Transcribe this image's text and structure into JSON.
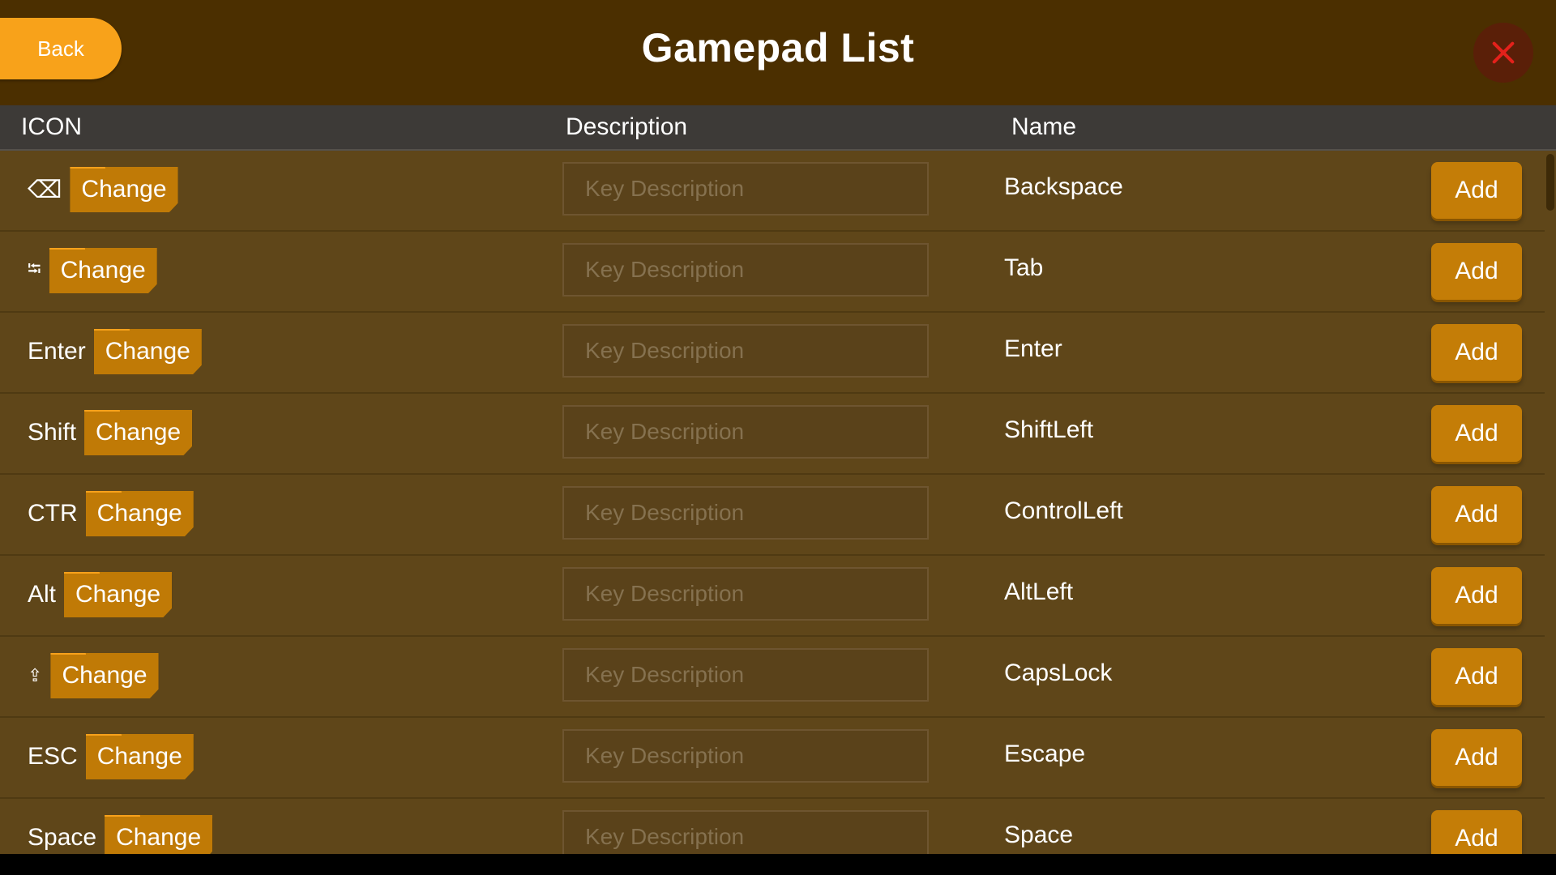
{
  "header": {
    "back_label": "Back",
    "title": "Gamepad List",
    "close_color": "#e3211b"
  },
  "columns": {
    "icon": "ICON",
    "description": "Description",
    "name": "Name"
  },
  "colors": {
    "header_bg": "#4b2f00",
    "body_bg": "#5f4619",
    "accent": "#f8a21a",
    "button": "#c47d07"
  },
  "rows": [
    {
      "icon_text": "⌫",
      "icon_name": "backspace-icon",
      "change_label": "Change",
      "placeholder": "Key Description",
      "name": "Backspace",
      "add_label": "Add"
    },
    {
      "icon_text": "⭾",
      "icon_name": "tab-icon",
      "change_label": "Change",
      "placeholder": "Key Description",
      "name": "Tab",
      "add_label": "Add"
    },
    {
      "icon_text": "Enter",
      "icon_name": "enter-key-label",
      "change_label": "Change",
      "placeholder": "Key Description",
      "name": "Enter",
      "add_label": "Add"
    },
    {
      "icon_text": "Shift",
      "icon_name": "shift-key-label",
      "change_label": "Change",
      "placeholder": "Key Description",
      "name": "ShiftLeft",
      "add_label": "Add"
    },
    {
      "icon_text": "CTR",
      "icon_name": "control-key-label",
      "change_label": "Change",
      "placeholder": "Key Description",
      "name": "ControlLeft",
      "add_label": "Add"
    },
    {
      "icon_text": "Alt",
      "icon_name": "alt-key-label",
      "change_label": "Change",
      "placeholder": "Key Description",
      "name": "AltLeft",
      "add_label": "Add"
    },
    {
      "icon_text": "⇪",
      "icon_name": "capslock-icon",
      "change_label": "Change",
      "placeholder": "Key Description",
      "name": "CapsLock",
      "add_label": "Add"
    },
    {
      "icon_text": "ESC",
      "icon_name": "escape-key-label",
      "change_label": "Change",
      "placeholder": "Key Description",
      "name": "Escape",
      "add_label": "Add"
    },
    {
      "icon_text": "Space",
      "icon_name": "space-key-label",
      "change_label": "Change",
      "placeholder": "Key Description",
      "name": "Space",
      "add_label": "Add"
    }
  ]
}
